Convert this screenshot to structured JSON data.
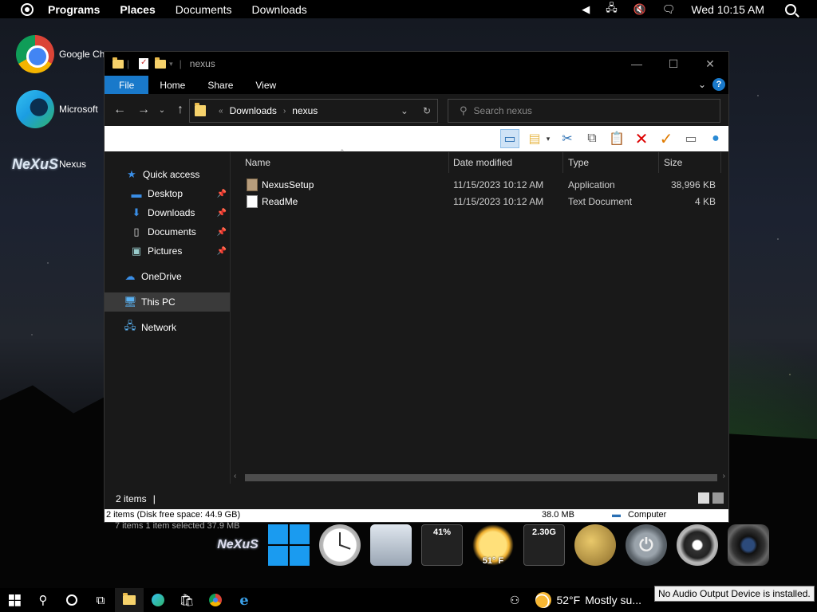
{
  "topbar": {
    "menus": [
      "Programs",
      "Places",
      "Documents",
      "Downloads"
    ],
    "clock": "Wed 10:15 AM"
  },
  "desktop": {
    "icons": [
      {
        "label": "Google Ch",
        "icon": "chrome-icon"
      },
      {
        "label": "Microsoft",
        "icon": "edge-icon"
      },
      {
        "label": "Nexus",
        "icon": "nexus-icon"
      }
    ],
    "nexus_logo_text": "NeXuS"
  },
  "window": {
    "title": "nexus",
    "controls": {
      "minimize": "—",
      "maximize": "☐",
      "close": "✕"
    },
    "ribbon_tabs": [
      "File",
      "Home",
      "Share",
      "View"
    ],
    "help": "?",
    "address": {
      "crumbs": [
        "Downloads",
        "nexus"
      ]
    },
    "search_placeholder": "Search nexus",
    "nav_pane": {
      "quick_access": "Quick access",
      "pinned": [
        "Desktop",
        "Downloads",
        "Documents",
        "Pictures"
      ],
      "onedrive": "OneDrive",
      "this_pc": "This PC",
      "network": "Network"
    },
    "columns": [
      "Name",
      "Date modified",
      "Type",
      "Size"
    ],
    "files": [
      {
        "name": "NexusSetup",
        "date": "11/15/2023 10:12 AM",
        "type": "Application",
        "size": "38,996 KB"
      },
      {
        "name": "ReadMe",
        "date": "11/15/2023 10:12 AM",
        "type": "Text Document",
        "size": "4 KB"
      }
    ],
    "status": {
      "items": "2 items",
      "cursor": "|"
    },
    "status2": {
      "left": "2 items (Disk free space: 44.9 GB)",
      "size": "38.0 MB",
      "location": "Computer"
    }
  },
  "dock": {
    "ghost_text": "7 items    1 item selected  37.9 MB",
    "cpu": "41%",
    "weather_temp": "51° F",
    "net": "2.30G",
    "nexus_text": "NeXuS"
  },
  "taskbar": {
    "temp": "52°F",
    "weather": "Mostly su...",
    "tooltip": "No Audio Output Device is installed."
  }
}
